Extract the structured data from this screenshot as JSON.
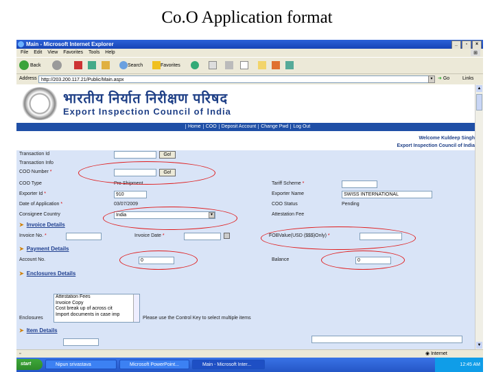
{
  "slide_title": "Co.O Application format",
  "window": {
    "title": "Main - Microsoft Internet Explorer",
    "buttons": [
      "_",
      "×"
    ]
  },
  "menu": [
    "File",
    "Edit",
    "View",
    "Favorites",
    "Tools",
    "Help"
  ],
  "toolbar": {
    "back": "Back",
    "search": "Search",
    "favorites": "Favorites"
  },
  "address": {
    "label": "Address",
    "url": "http://203.200.117.21/Public/Main.aspx",
    "go": "Go",
    "links": "Links"
  },
  "site": {
    "hindi_name": "भारतीय निर्यात निरीक्षण परिषद",
    "english_name": "Export Inspection Council of India",
    "nav": [
      "Home",
      "COO",
      "Deposit Account",
      "Change Pwd",
      "Log Out"
    ],
    "welcome": "Welcome Kuldeep Singh",
    "org": "Export Inspection Council of India"
  },
  "form": {
    "transaction_id_label": "Transaction Id",
    "go_label": "Go!",
    "transaction_info": "Transaction Info",
    "coo_number_label": "COO Number",
    "coo_type_label": "COO Type",
    "coo_type_value": "Pre Shipment",
    "tariff_scheme_label": "Tariff Scheme",
    "exporter_id_label": "Exporter Id",
    "exporter_id_value": "910",
    "exporter_name_label": "Exporter Name",
    "exporter_name_value": "SWISS INTERNATIONAL",
    "date_label": "Date of Application",
    "date_value": "03/07/2009",
    "coo_status_label": "COO Status",
    "coo_status_value": "Pending",
    "country_label": "Consignee Country",
    "country_value": "India",
    "attr_label": "Attestation Fee",
    "required_mark": "*",
    "invoice_section": "Invoice Details",
    "invoice_no_label": "Invoice No.",
    "invoice_date_label": "Invoice Date",
    "fob_label": "FOBValue(USD ($$$)Only)",
    "payment_section": "Payment Details",
    "account_no_label": "Account No.",
    "account_no_value": "0",
    "balance_label": "Balance",
    "balance_value": "0",
    "enclosures_section": "Enclosures Details",
    "enclosures_label": "Enclosures",
    "enclosure_options": [
      "Attestation Fees",
      "Invoice Copy",
      "Cost break up of across cit",
      "Import documents in case imp"
    ],
    "enclosures_hint": "Please use the Control Key to select multiple items",
    "item_section": "Item Details"
  },
  "statusbar": {
    "zone": "Internet"
  },
  "taskbar": {
    "start": "start",
    "tasks": [
      "Nipun srivastava",
      "Microsoft PowerPoint...",
      "Main - Microsoft Inter..."
    ],
    "clock": "12:45 AM"
  },
  "colors": {
    "header_blue": "#1e3f86",
    "form_bg": "#d9e4f7",
    "highlight_red": "#e01818"
  }
}
